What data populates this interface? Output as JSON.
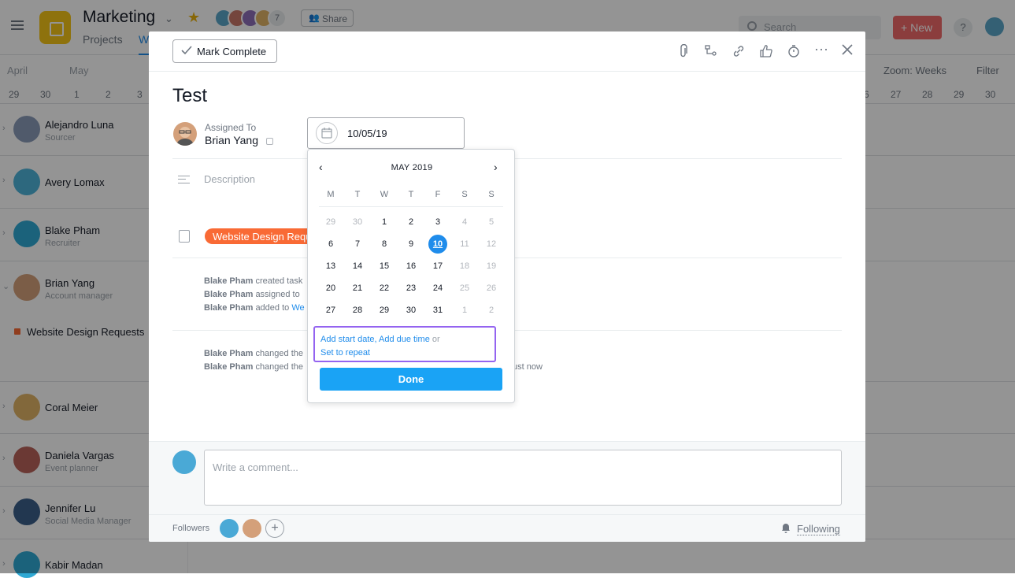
{
  "app": {
    "project_title": "Marketing",
    "tabs": [
      "Projects",
      "W"
    ],
    "share_label": "Share",
    "member_count": "7",
    "search_placeholder": "Search",
    "new_label": "New",
    "help_label": "?",
    "zoom_label": "Zoom: Weeks",
    "filter_label": "Filter",
    "months": [
      "April",
      "May"
    ],
    "left_days": [
      "29",
      "30",
      "1",
      "2",
      "3"
    ],
    "right_days": [
      "6",
      "27",
      "28",
      "29",
      "30"
    ],
    "people": [
      {
        "name": "Alejandro Luna",
        "role": "Sourcer"
      },
      {
        "name": "Avery Lomax",
        "role": ""
      },
      {
        "name": "Blake Pham",
        "role": "Recruiter"
      },
      {
        "name": "Brian Yang",
        "role": "Account manager"
      },
      {
        "name": "Website Design Requests",
        "role": ""
      },
      {
        "name": "Coral Meier",
        "role": ""
      },
      {
        "name": "Daniela Vargas",
        "role": "Event planner"
      },
      {
        "name": "Jennifer Lu",
        "role": "Social Media Manager"
      },
      {
        "name": "Kabir Madan",
        "role": ""
      }
    ]
  },
  "task": {
    "mark_complete_label": "Mark Complete",
    "title": "Test",
    "assigned_to_label": "Assigned To",
    "assignee": "Brian Yang",
    "due_date": "10/05/19",
    "description_placeholder": "Description",
    "project_tag": "Website Design Requests",
    "activity": [
      {
        "actor": "Blake Pham",
        "text": "created task"
      },
      {
        "actor": "Blake Pham",
        "text": "assigned to"
      },
      {
        "actor": "Blake Pham",
        "text": "added to",
        "link": "We"
      },
      {
        "actor": "Blake Pham",
        "text": "changed the"
      },
      {
        "actor": "Blake Pham",
        "text": "changed the",
        "tail": "ust now"
      }
    ],
    "comment_placeholder": "Write a comment...",
    "followers_label": "Followers",
    "following_label": "Following"
  },
  "datepicker": {
    "month_label": "MAY 2019",
    "weekdays": [
      "M",
      "T",
      "W",
      "T",
      "F",
      "S",
      "S"
    ],
    "weeks": [
      [
        "29",
        "30",
        "1",
        "2",
        "3",
        "4",
        "5"
      ],
      [
        "6",
        "7",
        "8",
        "9",
        "10",
        "11",
        "12"
      ],
      [
        "13",
        "14",
        "15",
        "16",
        "17",
        "18",
        "19"
      ],
      [
        "20",
        "21",
        "22",
        "23",
        "24",
        "25",
        "26"
      ],
      [
        "27",
        "28",
        "29",
        "30",
        "31",
        "1",
        "2"
      ]
    ],
    "selected_day": "10",
    "add_start_date": "Add start date",
    "add_due_time": "Add due time",
    "or_label": "or",
    "set_to_repeat": "Set to repeat",
    "done_label": "Done"
  },
  "colors": {
    "accent": "#1f8ceb",
    "project_tag": "#f96a35",
    "new_button": "#f06a6a",
    "highlight_border": "#9464f0"
  }
}
